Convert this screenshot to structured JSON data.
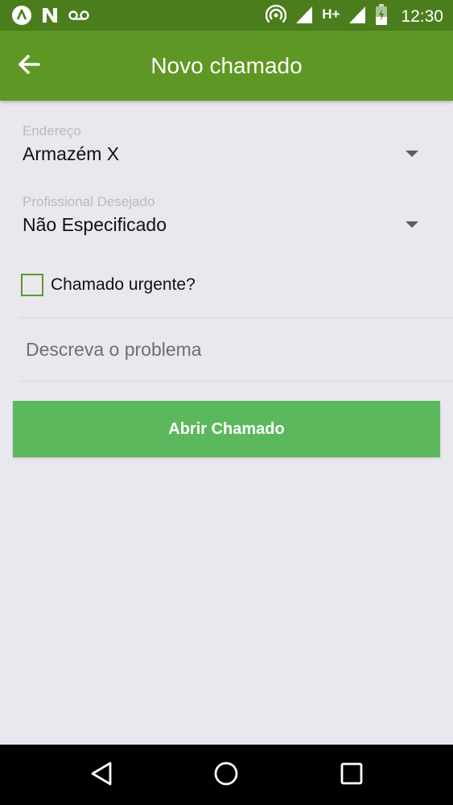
{
  "status_bar": {
    "time": "12:30",
    "network_type": "H+",
    "left_icons": [
      "app-a-icon",
      "n-notification-icon",
      "voicemail-icon"
    ],
    "right_icons": [
      "hotspot-icon",
      "signal-icon",
      "signal-h-plus-icon",
      "battery-icon"
    ]
  },
  "app_bar": {
    "title": "Novo chamado",
    "back_icon": "arrow-back-icon",
    "color": "#5f9724"
  },
  "form": {
    "address": {
      "label": "Endereço",
      "value": "Armazém X"
    },
    "professional": {
      "label": "Profissional Desejado",
      "value": "Não Especificado"
    },
    "urgent": {
      "label": "Chamado urgente?",
      "checked": false
    },
    "description": {
      "placeholder": "Descreva o problema",
      "value": ""
    },
    "submit_label": "Abrir Chamado"
  },
  "colors": {
    "status_bar": "#4b7d1d",
    "app_bar": "#5f9724",
    "button": "#5cb85c",
    "checkbox_border": "#5a9a2a",
    "background": "#e9e8ee"
  },
  "nav_bar": {
    "icons": [
      "back-triangle-icon",
      "home-circle-icon",
      "recents-square-icon"
    ]
  }
}
